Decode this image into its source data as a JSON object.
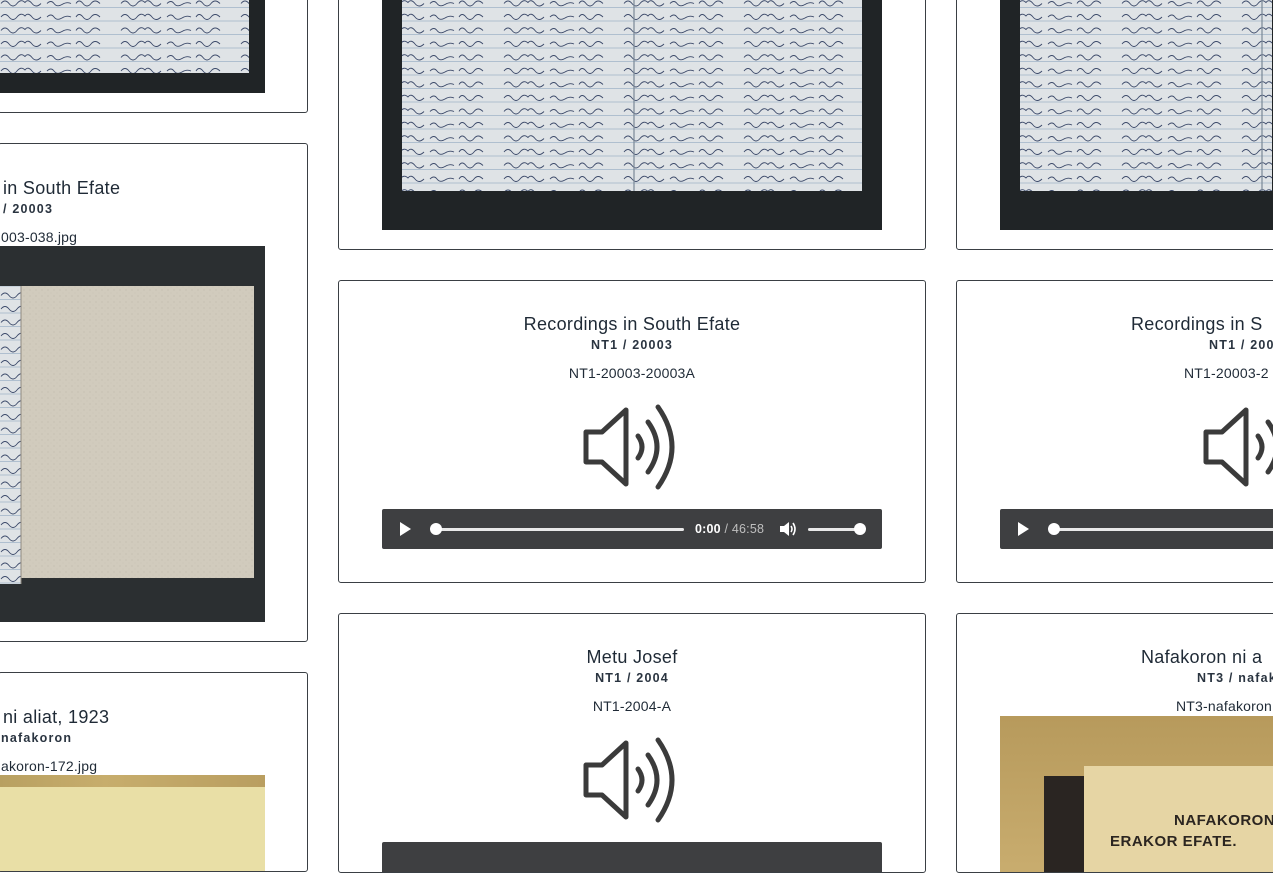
{
  "cards": {
    "left_top": {},
    "left_mid": {
      "title": "in South Efate",
      "subtitle": "/ 20003",
      "filename": "003-038.jpg"
    },
    "left_bottom": {
      "title": "ni aliat, 1923",
      "subtitle": "nafakoron",
      "filename": "akoron-172.jpg"
    },
    "mid_top": {},
    "right_top": {},
    "mid_audio": {
      "title": "Recordings in South Efate",
      "subtitle": "NT1 / 20003",
      "filename": "NT1-20003-20003A",
      "icon": "speaker-icon",
      "player": {
        "current_time": "0:00",
        "separator": " / ",
        "duration": "46:58",
        "progress": 0,
        "volume": 1
      }
    },
    "right_audio": {
      "title": "Recordings in S",
      "subtitle": "NT1 / 200",
      "filename": "NT1-20003-2",
      "icon": "speaker-icon"
    },
    "mid_bottom": {
      "title": "Metu Josef",
      "subtitle": "NT1 / 2004",
      "filename": "NT1-2004-A",
      "icon": "speaker-icon"
    },
    "right_bottom": {
      "title": "Nafakoron ni a",
      "subtitle": "NT3 / nafak",
      "filename": "NT3-nafakoron",
      "photo_text_1": "NAFAKORON",
      "photo_text_2": "ERAKOR EFATE."
    }
  },
  "colors": {
    "border": "#3a3f44",
    "player_bg": "#3e3f41",
    "text": "#1f2a36"
  }
}
